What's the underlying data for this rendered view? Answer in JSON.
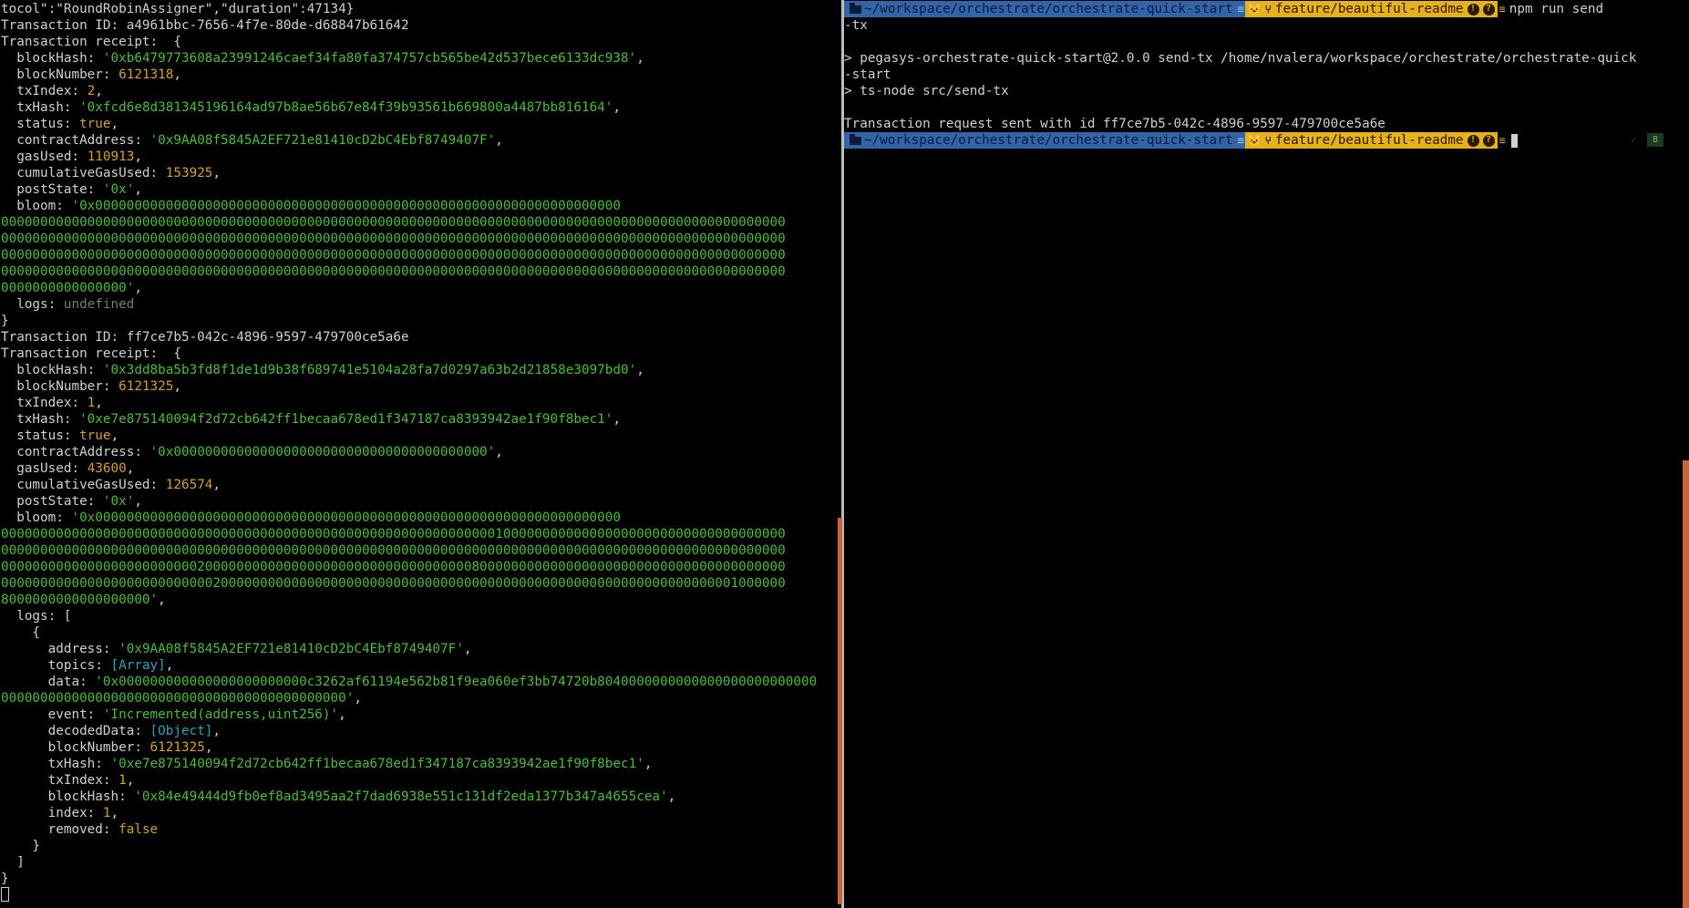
{
  "left_terminal": {
    "lines": [
      [
        {
          "t": "tocol\":\"RoundRobinAssigner\",\"duration\":47134}",
          "c": "k"
        }
      ],
      [
        {
          "t": "Transaction ID: a4961bbc-7656-4f7e-80de-d68847b61642",
          "c": "k"
        }
      ],
      [
        {
          "t": "Transaction receipt:  {",
          "c": "k"
        }
      ],
      [
        {
          "t": "  blockHash: ",
          "c": "k"
        },
        {
          "t": "'0xb6479773608a23991246caef34fa80fa374757cb565be42d537bece6133dc938'",
          "c": "s"
        },
        {
          "t": ",",
          "c": "k"
        }
      ],
      [
        {
          "t": "  blockNumber: ",
          "c": "k"
        },
        {
          "t": "6121318",
          "c": "n"
        },
        {
          "t": ",",
          "c": "k"
        }
      ],
      [
        {
          "t": "  txIndex: ",
          "c": "k"
        },
        {
          "t": "2",
          "c": "n"
        },
        {
          "t": ",",
          "c": "k"
        }
      ],
      [
        {
          "t": "  txHash: ",
          "c": "k"
        },
        {
          "t": "'0xfcd6e8d381345196164ad97b8ae56b67e84f39b93561b669800a4487bb816164'",
          "c": "s"
        },
        {
          "t": ",",
          "c": "k"
        }
      ],
      [
        {
          "t": "  status: ",
          "c": "k"
        },
        {
          "t": "true",
          "c": "n"
        },
        {
          "t": ",",
          "c": "k"
        }
      ],
      [
        {
          "t": "  contractAddress: ",
          "c": "k"
        },
        {
          "t": "'0x9AA08f5845A2EF721e81410cD2bC4Ebf8749407F'",
          "c": "s"
        },
        {
          "t": ",",
          "c": "k"
        }
      ],
      [
        {
          "t": "  gasUsed: ",
          "c": "k"
        },
        {
          "t": "110913",
          "c": "n"
        },
        {
          "t": ",",
          "c": "k"
        }
      ],
      [
        {
          "t": "  cumulativeGasUsed: ",
          "c": "k"
        },
        {
          "t": "153925",
          "c": "n"
        },
        {
          "t": ",",
          "c": "k"
        }
      ],
      [
        {
          "t": "  postState: ",
          "c": "k"
        },
        {
          "t": "'0x'",
          "c": "s"
        },
        {
          "t": ",",
          "c": "k"
        }
      ],
      [
        {
          "t": "  bloom: ",
          "c": "k"
        },
        {
          "t": "'0x0000000000000000000000000000000000000000000000000000000000000000000",
          "c": "s"
        }
      ],
      [
        {
          "t": "0000000000000000000000000000000000000000000000000000000000000000000000000000000000000000000000000000",
          "c": "s"
        }
      ],
      [
        {
          "t": "0000000000000000000000000000000000000000000000000000000000000000000000000000000000000000000000000000",
          "c": "s"
        }
      ],
      [
        {
          "t": "0000000000000000000000000000000000000000000000000000000000000000000000000000000000000000000000000000",
          "c": "s"
        }
      ],
      [
        {
          "t": "0000000000000000000000000000000000000000000000000000000000000000000000000000000000000000000000000000",
          "c": "s"
        }
      ],
      [
        {
          "t": "0000000000000000'",
          "c": "s"
        },
        {
          "t": ",",
          "c": "k"
        }
      ],
      [
        {
          "t": "  logs: ",
          "c": "k"
        },
        {
          "t": "undefined",
          "c": "u"
        }
      ],
      [
        {
          "t": "}",
          "c": "k"
        }
      ],
      [
        {
          "t": "Transaction ID: ff7ce7b5-042c-4896-9597-479700ce5a6e",
          "c": "k"
        }
      ],
      [
        {
          "t": "Transaction receipt:  {",
          "c": "k"
        }
      ],
      [
        {
          "t": "  blockHash: ",
          "c": "k"
        },
        {
          "t": "'0x3dd8ba5b3fd8f1de1d9b38f689741e5104a28fa7d0297a63b2d21858e3097bd0'",
          "c": "s"
        },
        {
          "t": ",",
          "c": "k"
        }
      ],
      [
        {
          "t": "  blockNumber: ",
          "c": "k"
        },
        {
          "t": "6121325",
          "c": "n"
        },
        {
          "t": ",",
          "c": "k"
        }
      ],
      [
        {
          "t": "  txIndex: ",
          "c": "k"
        },
        {
          "t": "1",
          "c": "n"
        },
        {
          "t": ",",
          "c": "k"
        }
      ],
      [
        {
          "t": "  txHash: ",
          "c": "k"
        },
        {
          "t": "'0xe7e875140094f2d72cb642ff1becaa678ed1f347187ca8393942ae1f90f8bec1'",
          "c": "s"
        },
        {
          "t": ",",
          "c": "k"
        }
      ],
      [
        {
          "t": "  status: ",
          "c": "k"
        },
        {
          "t": "true",
          "c": "n"
        },
        {
          "t": ",",
          "c": "k"
        }
      ],
      [
        {
          "t": "  contractAddress: ",
          "c": "k"
        },
        {
          "t": "'0x0000000000000000000000000000000000000000'",
          "c": "s"
        },
        {
          "t": ",",
          "c": "k"
        }
      ],
      [
        {
          "t": "  gasUsed: ",
          "c": "k"
        },
        {
          "t": "43600",
          "c": "n"
        },
        {
          "t": ",",
          "c": "k"
        }
      ],
      [
        {
          "t": "  cumulativeGasUsed: ",
          "c": "k"
        },
        {
          "t": "126574",
          "c": "n"
        },
        {
          "t": ",",
          "c": "k"
        }
      ],
      [
        {
          "t": "  postState: ",
          "c": "k"
        },
        {
          "t": "'0x'",
          "c": "s"
        },
        {
          "t": ",",
          "c": "k"
        }
      ],
      [
        {
          "t": "  bloom: ",
          "c": "k"
        },
        {
          "t": "'0x0000000000000000000000000000000000000000000000000000000000000000000",
          "c": "s"
        }
      ],
      [
        {
          "t": "0000000000000000000000000000000000000000000000000000000000000001000000000000000000000000000000000000",
          "c": "s"
        }
      ],
      [
        {
          "t": "0000000000000000000000000000000000000000000000000000000000000000000000000000000000000000000000000000",
          "c": "s"
        }
      ],
      [
        {
          "t": "0000000000000000000000000200000000000000000000000000000000008000000000000000000000000000000000000000",
          "c": "s"
        }
      ],
      [
        {
          "t": "0000000000000000000000000002000000000000000000000000000000000000000000000000000000000000000001000000",
          "c": "s"
        }
      ],
      [
        {
          "t": "8000000000000000000'",
          "c": "s"
        },
        {
          "t": ",",
          "c": "k"
        }
      ],
      [
        {
          "t": "  logs: [",
          "c": "k"
        }
      ],
      [
        {
          "t": "    {",
          "c": "k"
        }
      ],
      [
        {
          "t": "      address: ",
          "c": "k"
        },
        {
          "t": "'0x9AA08f5845A2EF721e81410cD2bC4Ebf8749407F'",
          "c": "s"
        },
        {
          "t": ",",
          "c": "k"
        }
      ],
      [
        {
          "t": "      topics: ",
          "c": "k"
        },
        {
          "t": "[Array]",
          "c": "c"
        },
        {
          "t": ",",
          "c": "k"
        }
      ],
      [
        {
          "t": "      data: ",
          "c": "k"
        },
        {
          "t": "'0x000000000000000000000000c3262af61194e562b81f9ea060ef3bb74720b8040000000000000000000000000",
          "c": "s"
        }
      ],
      [
        {
          "t": "00000000000000000000000000000000000000000000'",
          "c": "s"
        },
        {
          "t": ",",
          "c": "k"
        }
      ],
      [
        {
          "t": "      event: ",
          "c": "k"
        },
        {
          "t": "'Incremented(address,uint256)'",
          "c": "s"
        },
        {
          "t": ",",
          "c": "k"
        }
      ],
      [
        {
          "t": "      decodedData: ",
          "c": "k"
        },
        {
          "t": "[Object]",
          "c": "c"
        },
        {
          "t": ",",
          "c": "k"
        }
      ],
      [
        {
          "t": "      blockNumber: ",
          "c": "k"
        },
        {
          "t": "6121325",
          "c": "n"
        },
        {
          "t": ",",
          "c": "k"
        }
      ],
      [
        {
          "t": "      txHash: ",
          "c": "k"
        },
        {
          "t": "'0xe7e875140094f2d72cb642ff1becaa678ed1f347187ca8393942ae1f90f8bec1'",
          "c": "s"
        },
        {
          "t": ",",
          "c": "k"
        }
      ],
      [
        {
          "t": "      txIndex: ",
          "c": "k"
        },
        {
          "t": "1",
          "c": "n"
        },
        {
          "t": ",",
          "c": "k"
        }
      ],
      [
        {
          "t": "      blockHash: ",
          "c": "k"
        },
        {
          "t": "'0x84e49444d9fb0ef8ad3495aa2f7dad6938e551c131df2eda1377b347a4655cea'",
          "c": "s"
        },
        {
          "t": ",",
          "c": "k"
        }
      ],
      [
        {
          "t": "      index: ",
          "c": "k"
        },
        {
          "t": "1",
          "c": "n"
        },
        {
          "t": ",",
          "c": "k"
        }
      ],
      [
        {
          "t": "      removed: ",
          "c": "k"
        },
        {
          "t": "false",
          "c": "n"
        }
      ],
      [
        {
          "t": "    }",
          "c": "k"
        }
      ],
      [
        {
          "t": "  ]",
          "c": "k"
        }
      ],
      [
        {
          "t": "}",
          "c": "k"
        }
      ]
    ]
  },
  "right_terminal": {
    "prompt": {
      "path": "~/workspace/orchestrate/orchestrate-quick-start",
      "branch": "feature/beautiful-readme",
      "folder_icon": "folder-icon",
      "git_icon": "github-cat-icon",
      "branch_icon": "branch-icon",
      "warn_icon": "warning-icon",
      "question_icon": "question-icon"
    },
    "command_line_1": "npm run send",
    "command_line_2": "-tx",
    "output": [
      "",
      "> pegasys-orchestrate-quick-start@2.0.0 send-tx /home/nvalera/workspace/orchestrate/orchestrate-quick",
      "-start",
      "> ts-node src/send-tx",
      "",
      "Transaction request sent with id ff7ce7b5-042c-4896-9597-479700ce5a6e"
    ],
    "history_badge": "8",
    "history_left": "✓"
  },
  "colors": {
    "background": "#000000",
    "string": "#4dbb3c",
    "number": "#d2a12c",
    "undefined": "#7a7a7a",
    "special": "#2ea4b8",
    "path_segment": "#3264a8",
    "git_segment": "#e6b11a",
    "scroll_indicator": "#c8653a"
  }
}
